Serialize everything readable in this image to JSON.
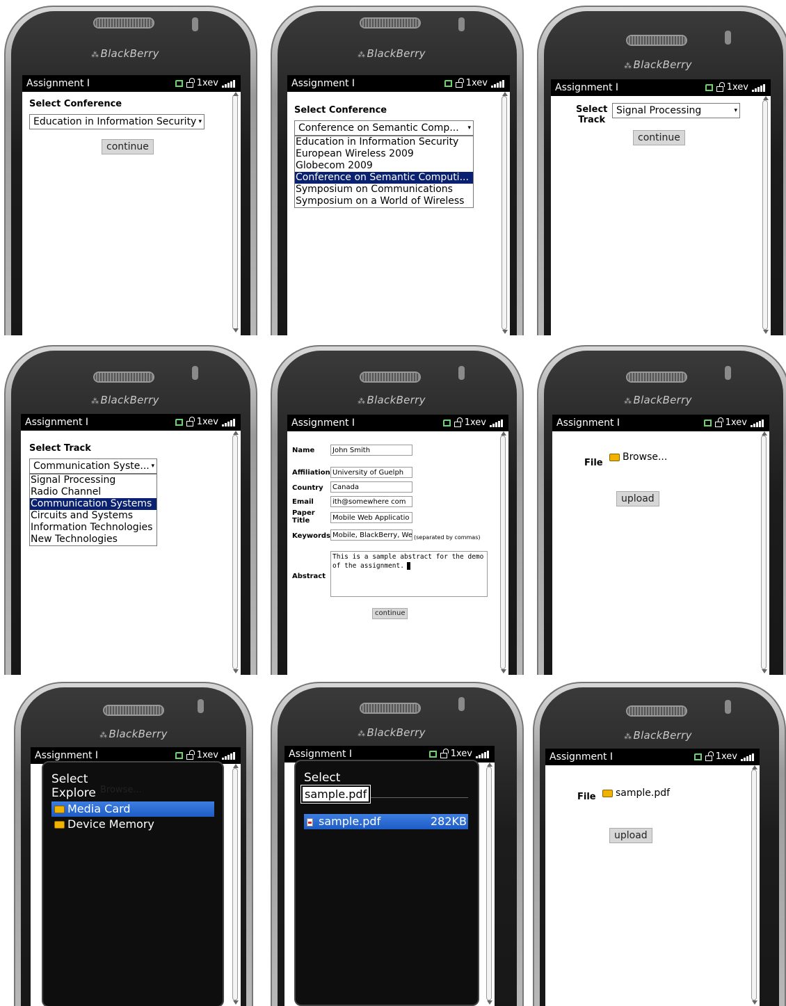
{
  "device": {
    "brand": "BlackBerry",
    "app_title": "Assignment I",
    "status_carrier": "1xev"
  },
  "screens": {
    "s1": {
      "heading": "Select Conference",
      "select_value": "Education in Information Security",
      "button": "continue"
    },
    "s2": {
      "heading": "Select Conference",
      "select_value": "Conference on Semantic Comp...",
      "options": [
        "Education in Information Security",
        "European Wireless 2009",
        "Globecom 2009",
        "Conference on Semantic Computi...",
        "Symposium on Communications",
        "Symposium on a World of Wireless"
      ],
      "selected_index": 3
    },
    "s3": {
      "label": "Select Track",
      "label_line1": "Select",
      "label_line2": "Track",
      "select_value": "Signal Processing",
      "button": "continue"
    },
    "s4": {
      "heading": "Select Track",
      "select_value": "Communication Syste...",
      "options": [
        "Signal Processing",
        "Radio Channel",
        "Communication Systems",
        "Circuits and Systems",
        "Information Technologies",
        "New Technologies"
      ],
      "selected_index": 2
    },
    "s5": {
      "name_label": "Name",
      "name_value": "John Smith",
      "affiliation_label": "Affiliation",
      "affiliation_value": "University of Guelph",
      "country_label": "Country",
      "country_value": "Canada",
      "email_label": "Email",
      "email_value": "ith@somewhere com",
      "paper_label_1": "Paper",
      "paper_label_2": "Title",
      "paper_value": "Mobile Web Applicatio",
      "keywords_label": "Keywords",
      "keywords_value": "Mobile, BlackBerry, We",
      "keywords_hint": "(separated by commas)",
      "abstract_label": "Abstract",
      "abstract_value": "This is a sample abstract for the demo of the assignment.",
      "button": "continue"
    },
    "s6": {
      "file_label": "File",
      "browse_label": "Browse...",
      "button": "upload"
    },
    "s7": {
      "popup_title": "Select",
      "popup_subtitle": "Explore",
      "behind_text": "Browse...",
      "items": [
        "Media Card",
        "Device Memory"
      ],
      "selected_index": 0
    },
    "s8": {
      "popup_title": "Select",
      "filename_tip": "sample.pdf",
      "file_name": "sample.pdf",
      "file_size": "282KB"
    },
    "s9": {
      "file_label": "File",
      "file_value": "sample.pdf",
      "button": "upload"
    }
  }
}
